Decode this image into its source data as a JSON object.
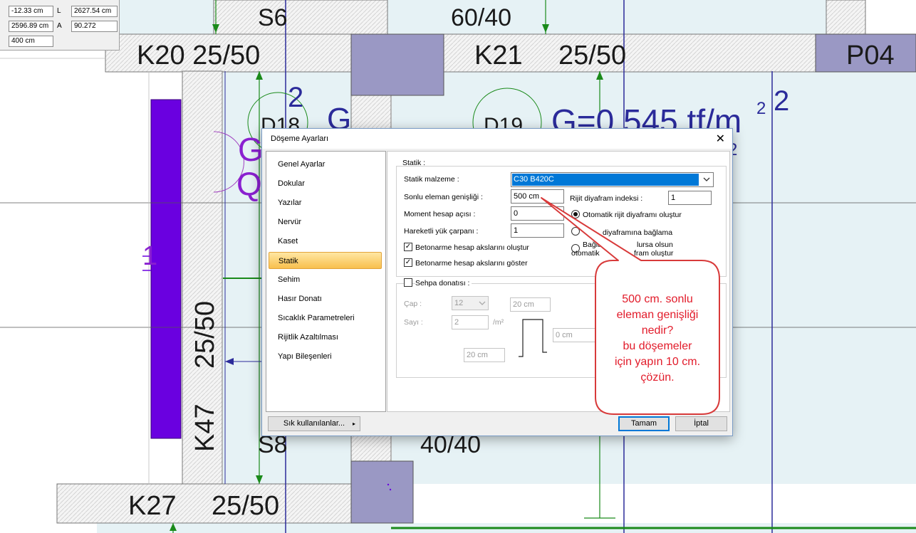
{
  "coords": {
    "x_label": "",
    "x_value": "-12.33 cm",
    "y_label": "",
    "y_value": "2596.89 cm",
    "z_label": "",
    "z_value": "400 cm",
    "l_label": "L",
    "l_value": "2627.54 cm",
    "a_label": "A",
    "a_value": "90.272"
  },
  "cad": {
    "s6": "S6",
    "top_size": "60/40",
    "k20": "K20 25/50",
    "k21": "K21",
    "k21_size": "25/50",
    "p04": "P04",
    "num2a": "2",
    "num2b": "2",
    "d18": "D18",
    "d19": "D19",
    "g_left": "G",
    "g_load": "G=0.545 tf/m",
    "sup2": "2",
    "sup2b": "2",
    "g_purple": "G",
    "q_purple": "Q",
    "k47": "K47",
    "k47_size": "25/50",
    "s8": "S8",
    "bottom_size": "40/40",
    "k27": "K27",
    "k27_size": "25/50",
    "one_frag": "1"
  },
  "dialog": {
    "title": "Döşeme Ayarları",
    "close": "✕",
    "nav": [
      "Genel Ayarlar",
      "Dokular",
      "Yazılar",
      "Nervür",
      "Kaset",
      "Statik",
      "Sehim",
      "Hasır Donatı",
      "Sıcaklık Parametreleri",
      "Rijitlik Azaltılması",
      "Yapı Bileşenleri"
    ],
    "active_nav": "Statik",
    "section_statik": "Statik :",
    "statik_malzeme_label": "Statik malzeme :",
    "statik_malzeme_value": "C30 B420C",
    "sonlu_label": "Sonlu eleman genişliği :",
    "sonlu_value": "500 cm",
    "moment_label": "Moment hesap açısı :",
    "moment_value": "0",
    "hareketli_label": "Hareketli yük çarpanı :",
    "hareketli_value": "1",
    "rijit_index_label": "Rijit diyafram indeksi :",
    "rijit_index_value": "1",
    "radio1": "Otomatik rijit diyaframı oluştur",
    "radio2": "diyaframına bağlama",
    "radio3a": "Bağla",
    "radio3b": "lursa olsun",
    "radio3c": "otomatik",
    "radio3d": "fram oluştur",
    "chk1": "Betonarme hesap akslarını oluştur",
    "chk2": "Betonarme hesap akslarını göster",
    "sehpa_label": "Sehpa donatısı :",
    "cap_label": "Çap :",
    "cap_value": "12",
    "sayi_label": "Sayı :",
    "sayi_value": "2",
    "per_m2": "/m²",
    "dim_top": "20 cm",
    "dim_right": "0 cm",
    "dim_bottom": "20 cm",
    "fav_button": "Sık kullanılanlar...",
    "ok_button": "Tamam",
    "cancel_button": "İptal"
  },
  "callout": {
    "lines": [
      "500 cm. sonlu",
      "eleman genişliği",
      "nedir?",
      "bu döşemeler",
      "için yapın 10 cm.",
      "çözün."
    ]
  }
}
